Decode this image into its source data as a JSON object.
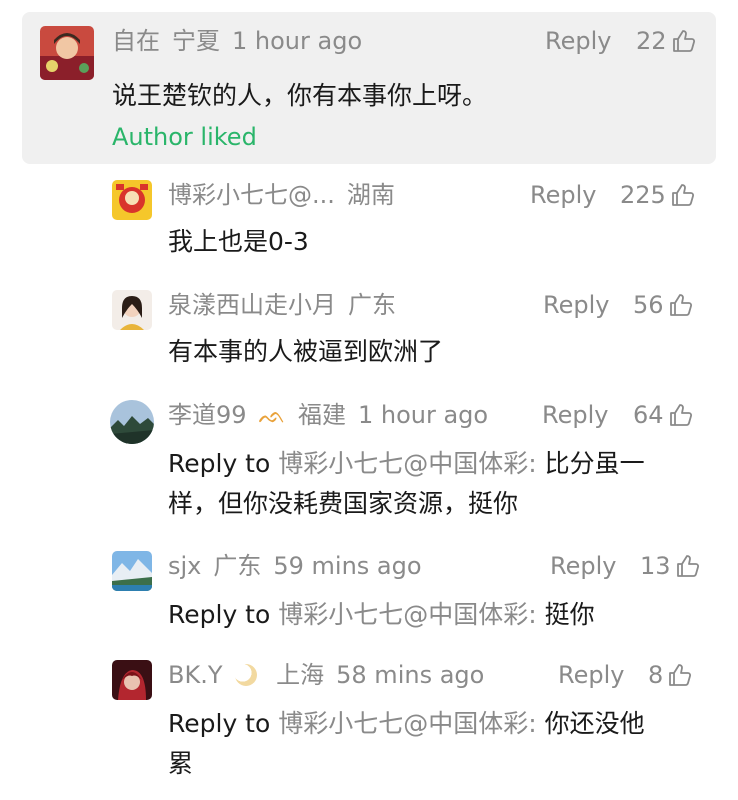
{
  "reply_label": "Reply",
  "author_liked_label": "Author liked",
  "reply_to_prefix": "Reply to",
  "comments": [
    {
      "name": "自在",
      "location": "宁夏",
      "time": "1 hour ago",
      "likes": "22",
      "text": "说王楚钦的人，你有本事你上呀。",
      "author_liked": true
    },
    {
      "name": "博彩小七七@...",
      "location": "湖南",
      "time": "",
      "likes": "225",
      "text": "我上也是0-3"
    },
    {
      "name": "泉漾西山走小月",
      "location": "广东",
      "time": "",
      "likes": "56",
      "text": "有本事的人被逼到欧洲了"
    },
    {
      "name": "李道99",
      "badge": "ᨒ",
      "location": "福建",
      "time": "1 hour ago",
      "likes": "64",
      "reply_target": "博彩小七七@中国体彩",
      "text_line1": "比分虽一",
      "text_line2": "样，但你没耗费国家资源，挺你"
    },
    {
      "name": "sjx",
      "location": "广东",
      "time": "59 mins ago",
      "likes": "13",
      "reply_target": "博彩小七七@中国体彩",
      "text_line1": "挺你"
    },
    {
      "name": "BK.Y",
      "location": "上海",
      "time": "58 mins ago",
      "likes": "8",
      "reply_target": "博彩小七七@中国体彩",
      "text_line1": "你还没他",
      "text_line2": "累"
    }
  ]
}
